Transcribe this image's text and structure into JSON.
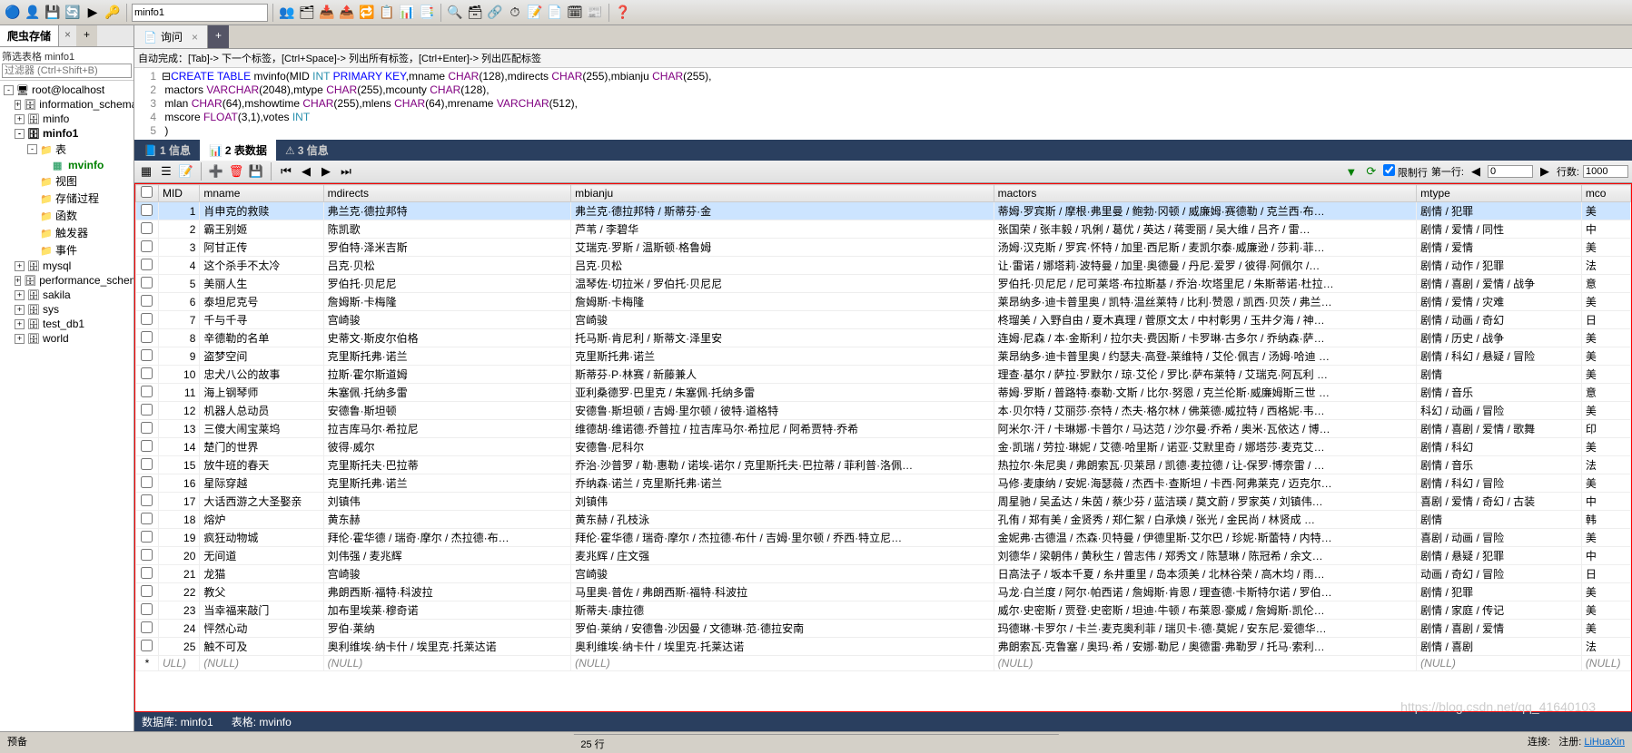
{
  "toolbar": {
    "combo_value": "minfo1"
  },
  "sidebar": {
    "tab_title": "爬虫存储",
    "filter_label": "筛选表格 minfo1",
    "filter_placeholder": "过滤器 (Ctrl+Shift+B)",
    "tree": {
      "host": "root@localhost",
      "dbs": [
        {
          "name": "information_schema",
          "expanded": false
        },
        {
          "name": "minfo",
          "expanded": false
        },
        {
          "name": "minfo1",
          "expanded": true,
          "bold": true,
          "children": [
            {
              "name": "表",
              "type": "folder",
              "expanded": true,
              "children": [
                {
                  "name": "mvinfo",
                  "type": "table",
                  "green": true
                }
              ]
            },
            {
              "name": "视图",
              "type": "folder"
            },
            {
              "name": "存储过程",
              "type": "folder"
            },
            {
              "name": "函数",
              "type": "folder"
            },
            {
              "name": "触发器",
              "type": "folder"
            },
            {
              "name": "事件",
              "type": "folder"
            }
          ]
        },
        {
          "name": "mysql",
          "expanded": false
        },
        {
          "name": "performance_schema",
          "expanded": false
        },
        {
          "name": "sakila",
          "expanded": false
        },
        {
          "name": "sys",
          "expanded": false
        },
        {
          "name": "test_db1",
          "expanded": false
        },
        {
          "name": "world",
          "expanded": false
        }
      ]
    }
  },
  "query_tab": "询问",
  "sql_hint": "自动完成：[Tab]-> 下一个标签，[Ctrl+Space]-> 列出所有标签，[Ctrl+Enter]-> 列出匹配标签",
  "sql_lines": [
    "1",
    "2",
    "3",
    "4",
    "5"
  ],
  "data_tabs": {
    "t1": "1 信息",
    "t2": "2 表数据",
    "t3": "3 信息"
  },
  "pager": {
    "limit_label": "限制行",
    "first_label": "第一行:",
    "first_value": "0",
    "rows_label": "行数:",
    "rows_value": "1000"
  },
  "columns": [
    "MID",
    "mname",
    "mdirects",
    "mbianju",
    "mactors",
    "mtype",
    "mco"
  ],
  "rows": [
    {
      "MID": 1,
      "mname": "肖申克的救赎",
      "mdirects": "弗兰克·德拉邦特",
      "mbianju": "弗兰克·德拉邦特 / 斯蒂芬·金",
      "mactors": "蒂姆·罗宾斯 / 摩根·弗里曼 / 鲍勃·冈顿 / 威廉姆·赛德勒 / 克兰西·布…",
      "mtype": "剧情 / 犯罪",
      "mco": "美"
    },
    {
      "MID": 2,
      "mname": "霸王别姬",
      "mdirects": "陈凯歌",
      "mbianju": "芦苇 / 李碧华",
      "mactors": "张国荣 / 张丰毅 / 巩俐 / 葛优 / 英达 / 蒋雯丽 / 吴大维 / 吕齐 / 雷…",
      "mtype": "剧情 / 爱情 / 同性",
      "mco": "中"
    },
    {
      "MID": 3,
      "mname": "阿甘正传",
      "mdirects": "罗伯特·泽米吉斯",
      "mbianju": "艾瑞克·罗斯 / 温斯顿·格鲁姆",
      "mactors": "汤姆·汉克斯 / 罗宾·怀特 / 加里·西尼斯 / 麦凯尔泰·威廉逊 / 莎莉·菲…",
      "mtype": "剧情 / 爱情",
      "mco": "美"
    },
    {
      "MID": 4,
      "mname": "这个杀手不太冷",
      "mdirects": "吕克·贝松",
      "mbianju": "吕克·贝松",
      "mactors": "让·雷诺 / 娜塔莉·波特曼 / 加里·奥德曼 / 丹尼·爱罗 / 彼得·阿佩尔 /…",
      "mtype": "剧情 / 动作 / 犯罪",
      "mco": "法"
    },
    {
      "MID": 5,
      "mname": "美丽人生",
      "mdirects": "罗伯托·贝尼尼",
      "mbianju": "温琴佐·切拉米 / 罗伯托·贝尼尼",
      "mactors": "罗伯托·贝尼尼 / 尼可莱塔·布拉斯基 / 乔治·坎塔里尼 / 朱斯蒂诺·杜拉…",
      "mtype": "剧情 / 喜剧 / 爱情 / 战争",
      "mco": "意"
    },
    {
      "MID": 6,
      "mname": "泰坦尼克号",
      "mdirects": "詹姆斯·卡梅隆",
      "mbianju": "詹姆斯·卡梅隆",
      "mactors": "莱昂纳多·迪卡普里奥 / 凯特·温丝莱特 / 比利·赞恩 / 凯西·贝茨 / 弗兰…",
      "mtype": "剧情 / 爱情 / 灾难",
      "mco": "美"
    },
    {
      "MID": 7,
      "mname": "千与千寻",
      "mdirects": "宫崎骏",
      "mbianju": "宫崎骏",
      "mactors": "柊瑠美 / 入野自由 / 夏木真理 / 菅原文太 / 中村彰男 / 玉井夕海 / 神…",
      "mtype": "剧情 / 动画 / 奇幻",
      "mco": "日"
    },
    {
      "MID": 8,
      "mname": "辛德勒的名单",
      "mdirects": "史蒂文·斯皮尔伯格",
      "mbianju": "托马斯·肯尼利 / 斯蒂文·泽里安",
      "mactors": "连姆·尼森 / 本·金斯利 / 拉尔夫·费因斯 / 卡罗琳·古多尔 / 乔纳森·萨…",
      "mtype": "剧情 / 历史 / 战争",
      "mco": "美"
    },
    {
      "MID": 9,
      "mname": "盗梦空间",
      "mdirects": "克里斯托弗·诺兰",
      "mbianju": "克里斯托弗·诺兰",
      "mactors": "莱昂纳多·迪卡普里奥 / 约瑟夫·高登-莱维特 / 艾伦·佩吉 / 汤姆·哈迪 …",
      "mtype": "剧情 / 科幻 / 悬疑 / 冒险",
      "mco": "美"
    },
    {
      "MID": 10,
      "mname": "忠犬八公的故事",
      "mdirects": "拉斯·霍尔斯道姆",
      "mbianju": "斯蒂芬·P·林赛 / 新藤兼人",
      "mactors": "理查·基尔 / 萨拉·罗默尔 / 琼·艾伦 / 罗比·萨布莱特 / 艾瑞克·阿瓦利 …",
      "mtype": "剧情",
      "mco": "美"
    },
    {
      "MID": 11,
      "mname": "海上钢琴师",
      "mdirects": "朱塞佩·托纳多雷",
      "mbianju": "亚利桑德罗·巴里克 / 朱塞佩·托纳多雷",
      "mactors": "蒂姆·罗斯 / 普路特·泰勒·文斯 / 比尔·努恩 / 克兰伦斯·威廉姆斯三世 …",
      "mtype": "剧情 / 音乐",
      "mco": "意"
    },
    {
      "MID": 12,
      "mname": "机器人总动员",
      "mdirects": "安德鲁·斯坦顿",
      "mbianju": "安德鲁·斯坦顿 / 吉姆·里尔顿 / 彼特·道格特",
      "mactors": "本·贝尔特 / 艾丽莎·奈特 / 杰夫·格尔林 / 佛莱德·威拉特 / 西格妮·韦…",
      "mtype": "科幻 / 动画 / 冒险",
      "mco": "美"
    },
    {
      "MID": 13,
      "mname": "三傻大闹宝莱坞",
      "mdirects": "拉吉库马尔·希拉尼",
      "mbianju": "维德胡·维诺德·乔普拉 / 拉吉库马尔·希拉尼 / 阿希贾特·乔希",
      "mactors": "阿米尔·汗 / 卡琳娜·卡普尔 / 马达范 / 沙尔曼·乔希 / 奥米·瓦依达 / 博…",
      "mtype": "剧情 / 喜剧 / 爱情 / 歌舞",
      "mco": "印"
    },
    {
      "MID": 14,
      "mname": "楚门的世界",
      "mdirects": "彼得·威尔",
      "mbianju": "安德鲁·尼科尔",
      "mactors": "金·凯瑞 / 劳拉·琳妮 / 艾德·哈里斯 / 诺亚·艾默里奇 / 娜塔莎·麦克艾…",
      "mtype": "剧情 / 科幻",
      "mco": "美"
    },
    {
      "MID": 15,
      "mname": "放牛班的春天",
      "mdirects": "克里斯托夫·巴拉蒂",
      "mbianju": "乔治·沙普罗 / 勒·惠勒 / 诺埃-诺尔 / 克里斯托夫·巴拉蒂 / 菲利普·洛佩…",
      "mactors": "热拉尔·朱尼奥 / 弗朗索瓦·贝莱昂 / 凯德·麦拉德 / 让-保罗·博奈雷 / …",
      "mtype": "剧情 / 音乐",
      "mco": "法"
    },
    {
      "MID": 16,
      "mname": "星际穿越",
      "mdirects": "克里斯托弗·诺兰",
      "mbianju": "乔纳森·诺兰 / 克里斯托弗·诺兰",
      "mactors": "马修·麦康纳 / 安妮·海瑟薇 / 杰西卡·查斯坦 / 卡西·阿弗莱克 / 迈克尔…",
      "mtype": "剧情 / 科幻 / 冒险",
      "mco": "美"
    },
    {
      "MID": 17,
      "mname": "大话西游之大圣娶亲",
      "mdirects": "刘镇伟",
      "mbianju": "刘镇伟",
      "mactors": "周星驰 / 吴孟达 / 朱茵 / 蔡少芬 / 蓝洁瑛 / 莫文蔚 / 罗家英 / 刘镇伟…",
      "mtype": "喜剧 / 爱情 / 奇幻 / 古装",
      "mco": "中"
    },
    {
      "MID": 18,
      "mname": "熔炉",
      "mdirects": "黄东赫",
      "mbianju": "黄东赫 / 孔枝泳",
      "mactors": "孔侑 / 郑有美 / 金贤秀 / 郑仁絮 / 白承焕 / 张光 / 金民尚 / 林贤成 …",
      "mtype": "剧情",
      "mco": "韩"
    },
    {
      "MID": 19,
      "mname": "疯狂动物城",
      "mdirects": "拜伦·霍华德 / 瑞奇·摩尔 / 杰拉德·布…",
      "mbianju": "拜伦·霍华德 / 瑞奇·摩尔 / 杰拉德·布什 / 吉姆·里尔顿 / 乔西·特立尼…",
      "mactors": "金妮弗·古德温 / 杰森·贝特曼 / 伊德里斯·艾尔巴 / 珍妮·斯蕾特 / 内特…",
      "mtype": "喜剧 / 动画 / 冒险",
      "mco": "美"
    },
    {
      "MID": 20,
      "mname": "无间道",
      "mdirects": "刘伟强 / 麦兆辉",
      "mbianju": "麦兆辉 / 庄文强",
      "mactors": "刘德华 / 梁朝伟 / 黄秋生 / 曾志伟 / 郑秀文 / 陈慧琳 / 陈冠希 / 余文…",
      "mtype": "剧情 / 悬疑 / 犯罪",
      "mco": "中"
    },
    {
      "MID": 21,
      "mname": "龙猫",
      "mdirects": "宫崎骏",
      "mbianju": "宫崎骏",
      "mactors": "日高法子 / 坂本千夏 / 糸井重里 / 岛本须美 / 北林谷荣 / 高木均 / 雨…",
      "mtype": "动画 / 奇幻 / 冒险",
      "mco": "日"
    },
    {
      "MID": 22,
      "mname": "教父",
      "mdirects": "弗朗西斯·福特·科波拉",
      "mbianju": "马里奥·普佐 / 弗朗西斯·福特·科波拉",
      "mactors": "马龙·白兰度 / 阿尔·帕西诺 / 詹姆斯·肯恩 / 理查德·卡斯特尔诺 / 罗伯…",
      "mtype": "剧情 / 犯罪",
      "mco": "美"
    },
    {
      "MID": 23,
      "mname": "当幸福来敲门",
      "mdirects": "加布里埃莱·穆奇诺",
      "mbianju": "斯蒂夫·康拉德",
      "mactors": "威尔·史密斯 / 贾登·史密斯 / 坦迪·牛顿 / 布莱恩·豪威 / 詹姆斯·凯伦…",
      "mtype": "剧情 / 家庭 / 传记",
      "mco": "美"
    },
    {
      "MID": 24,
      "mname": "怦然心动",
      "mdirects": "罗伯·莱纳",
      "mbianju": "罗伯·莱纳 / 安德鲁·沙因曼 / 文德琳·范·德拉安南",
      "mactors": "玛德琳·卡罗尔 / 卡兰·麦克奥利菲 / 瑞贝卡·德·莫妮 / 安东尼·爱德华…",
      "mtype": "剧情 / 喜剧 / 爱情",
      "mco": "美"
    },
    {
      "MID": 25,
      "mname": "触不可及",
      "mdirects": "奥利维埃·纳卡什 / 埃里克·托莱达诺",
      "mbianju": "奥利维埃·纳卡什 / 埃里克·托莱达诺",
      "mactors": "弗朗索瓦·克鲁塞 / 奥玛·希 / 安娜·勒尼 / 奥德雷·弗勒罗 / 托马·索利…",
      "mtype": "剧情 / 喜剧",
      "mco": "法"
    }
  ],
  "null_row": {
    "star": "*",
    "ull": "ULL)",
    "null": "(NULL)"
  },
  "status": {
    "db_label": "数据库:",
    "db": "minfo1",
    "tbl_label": "表格:",
    "tbl": "mvinfo",
    "rows": "25 行",
    "conn": "连接:",
    "user_label": "注册:",
    "user": "LiHuaXin",
    "ready": "预备"
  },
  "watermark": "https://blog.csdn.net/qq_41640103"
}
